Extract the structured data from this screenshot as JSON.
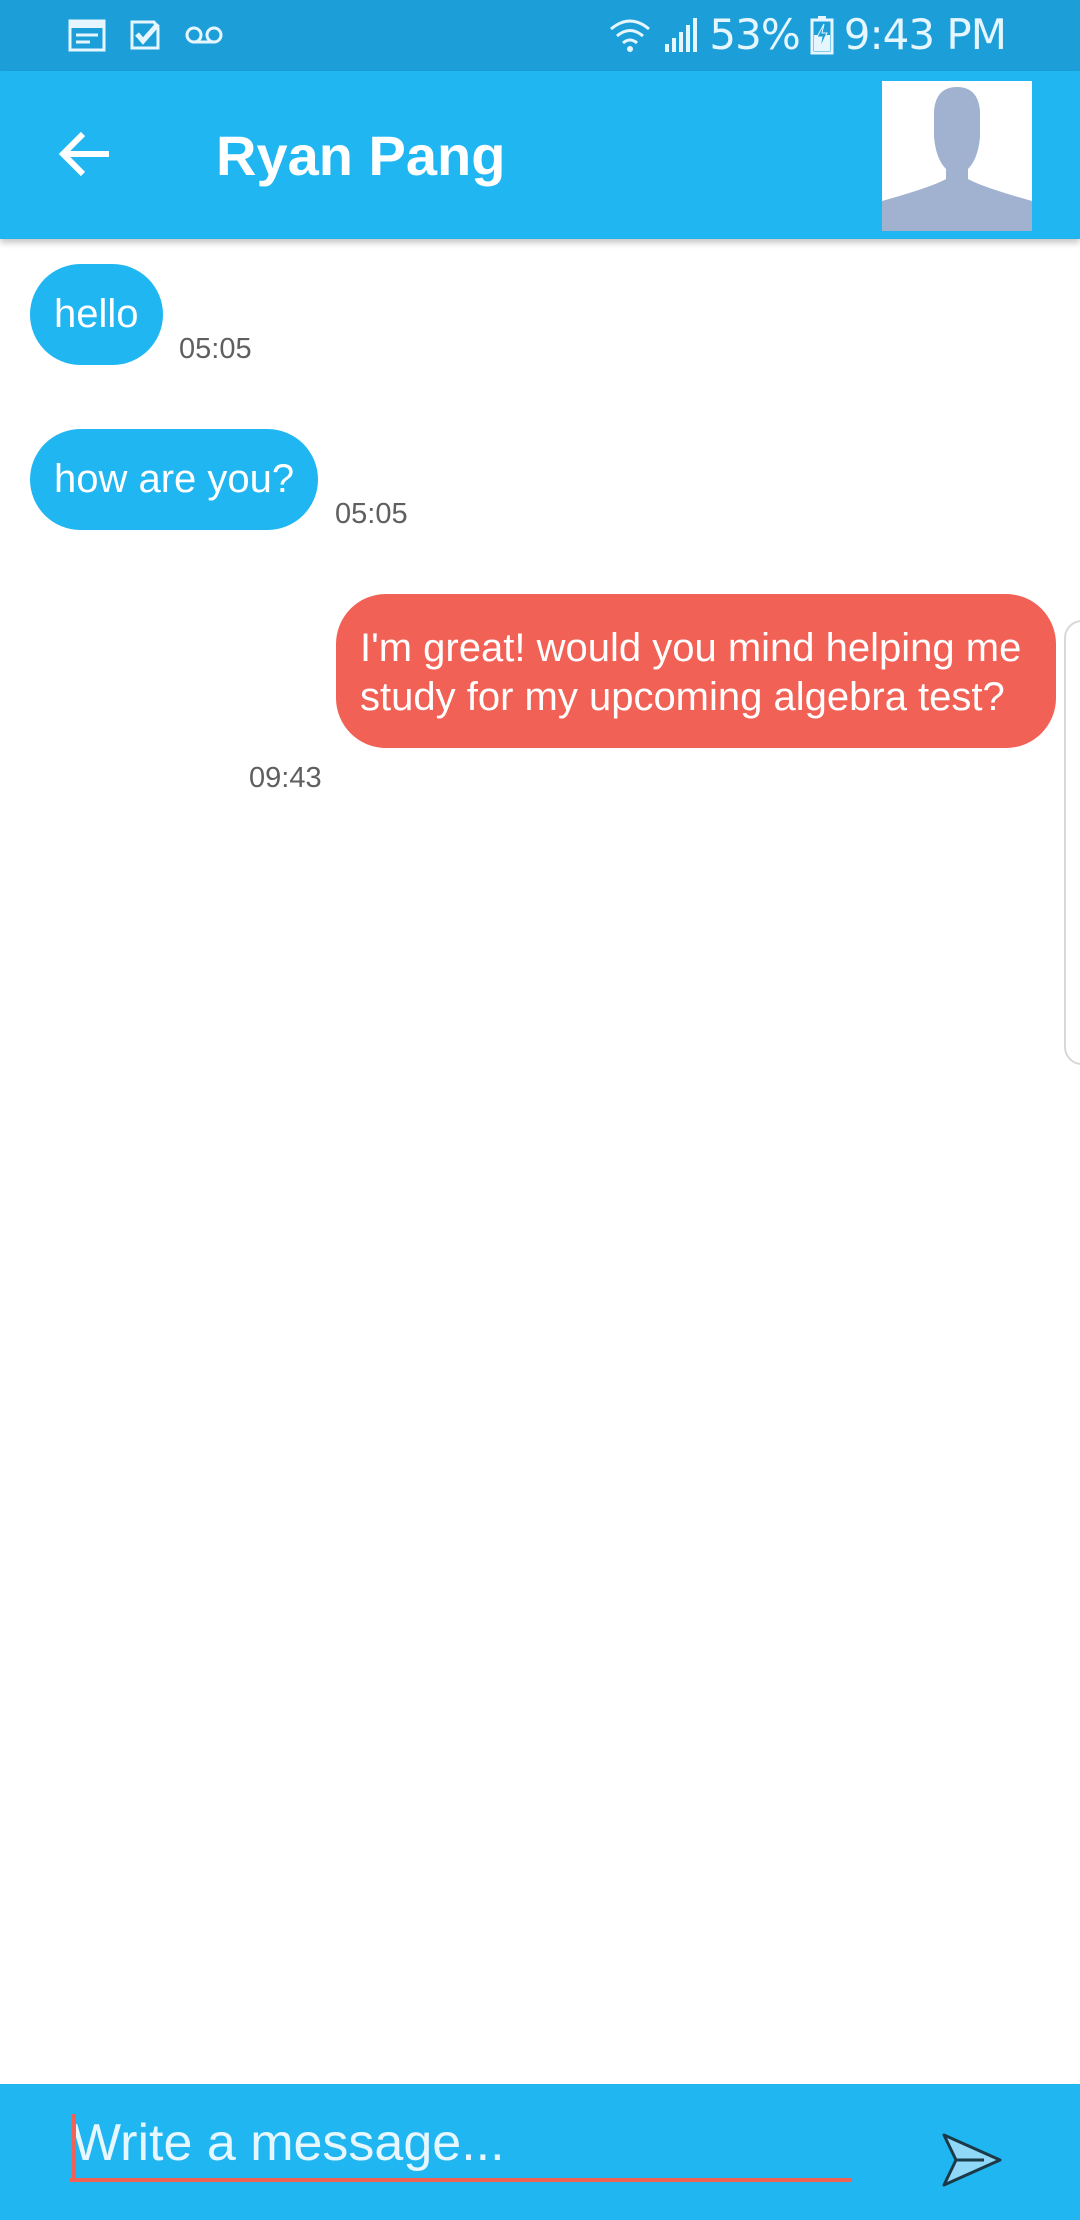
{
  "status_bar": {
    "icons_left": [
      "calendar-icon",
      "checklist-icon",
      "voicemail-icon"
    ],
    "battery": "53%",
    "time": "9:43 PM",
    "icons_right": [
      "wifi-icon",
      "signal-icon",
      "battery-charging-icon"
    ]
  },
  "header": {
    "title": "Ryan Pang",
    "back_icon": "arrow-left-icon",
    "avatar_icon": "person-silhouette-icon"
  },
  "messages": [
    {
      "direction": "incoming",
      "text": "hello",
      "time": "05:05"
    },
    {
      "direction": "incoming",
      "text": "how are you?",
      "time": "05:05"
    },
    {
      "direction": "outgoing",
      "text": "I'm great! would you mind helping me study for my upcoming algebra test?",
      "time": "09:43"
    }
  ],
  "composer": {
    "placeholder": "Write a message...",
    "send_icon": "send-icon"
  },
  "colors": {
    "status_bar": "#1c9fd9",
    "primary": "#20b6f2",
    "outgoing_bubble": "#f26155",
    "time_text": "#5f5f5f"
  }
}
